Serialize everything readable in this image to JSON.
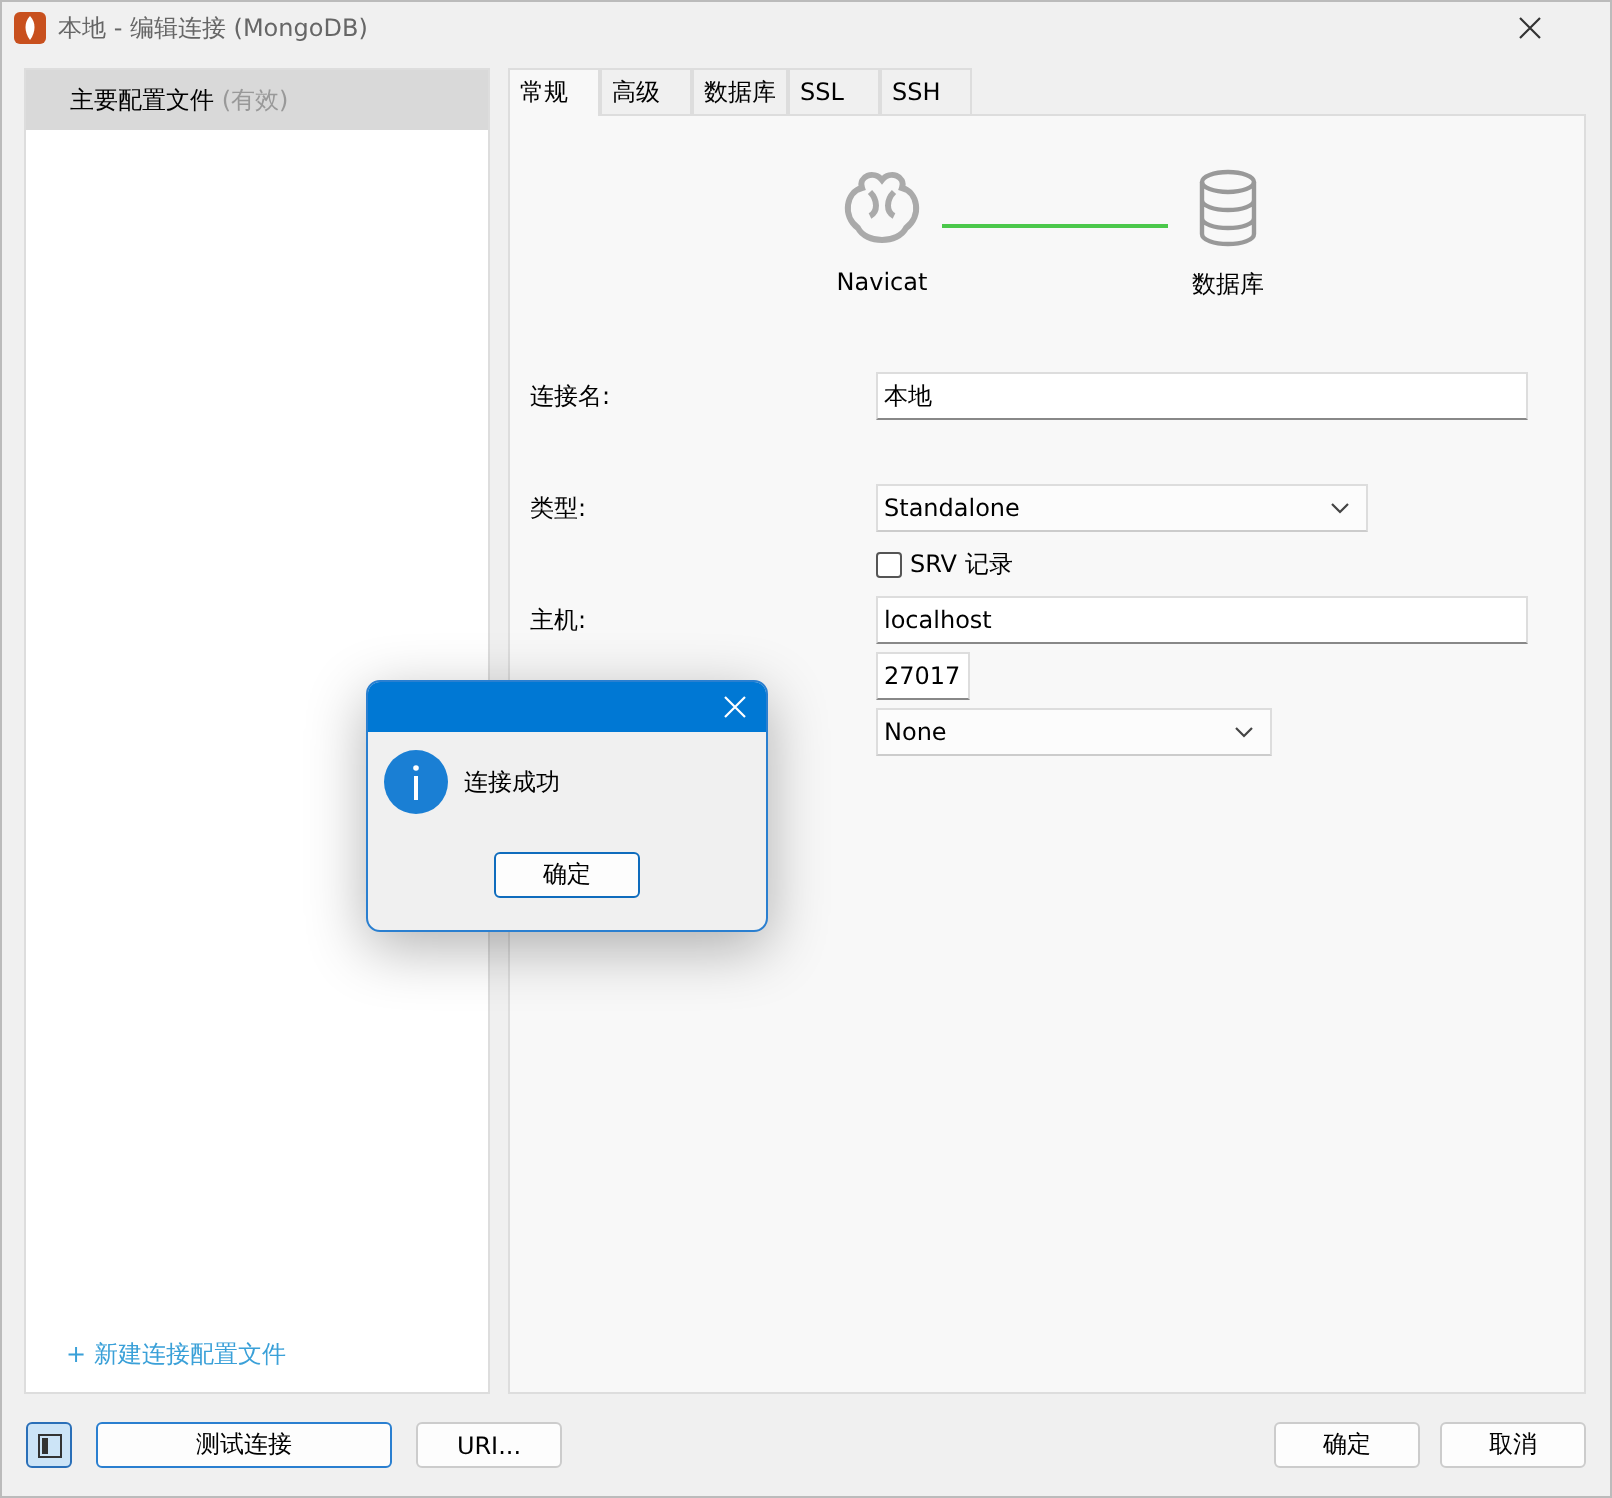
{
  "window": {
    "title": "本地 - 编辑连接 (MongoDB)"
  },
  "sidebar": {
    "items": [
      {
        "label": "主要配置文件",
        "status": "(有效)",
        "selected": true
      }
    ],
    "add_link": "+ 新建连接配置文件"
  },
  "tabs": [
    {
      "label": "常规",
      "selected": true
    },
    {
      "label": "高级",
      "selected": false
    },
    {
      "label": "数据库",
      "selected": false
    },
    {
      "label": "SSL",
      "selected": false
    },
    {
      "label": "SSH",
      "selected": false
    }
  ],
  "diagram": {
    "source": "Navicat",
    "target": "数据库"
  },
  "form": [
    {
      "kind": "text",
      "label": "连接名:",
      "value": "本地"
    },
    {
      "kind": "select",
      "label": "类型:",
      "value": "Standalone"
    },
    {
      "kind": "checkbox",
      "label": "SRV 记录",
      "checked": false
    },
    {
      "kind": "text",
      "label": "主机:",
      "value": "localhost"
    },
    {
      "kind": "text",
      "value": "27017"
    },
    {
      "kind": "select",
      "value": "None"
    }
  ],
  "footer": {
    "sidebar_toggle": {
      "pressed": true
    },
    "left_buttons": [
      "测试连接",
      "URI..."
    ],
    "right_buttons": [
      "确定",
      "取消"
    ]
  },
  "message_box": {
    "message": "连接成功",
    "button": "确定"
  }
}
